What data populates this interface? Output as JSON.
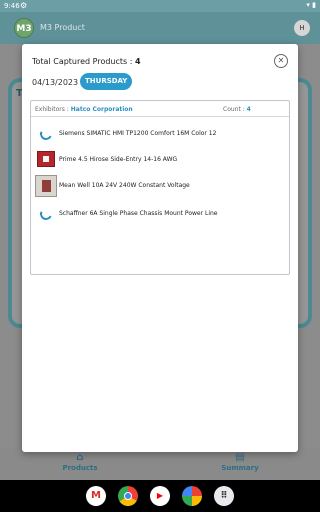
{
  "status_bar": {
    "time": "9:46",
    "gear_icon": "settings-icon",
    "right_icons": "wifi battery"
  },
  "app_bar": {
    "logo": "M3",
    "title": "M3 Product",
    "avatar": "H"
  },
  "background": {
    "title": "T",
    "bottom_nav": [
      {
        "label": "Products",
        "icon": "home-icon"
      },
      {
        "label": "Summary",
        "icon": "clipboard-icon"
      }
    ]
  },
  "modal": {
    "title_label": "Total Captured Products : ",
    "title_count": "4",
    "date": "04/13/2023",
    "day": "THURSDAY",
    "exhibitor_label": "Exhibitors : ",
    "exhibitor_value": "Hatco Corporation",
    "count_label": "Count : ",
    "count_value": "4",
    "products": [
      {
        "name": "Siemens SIMATIC HMI TP1200 Comfort 16M Color 12",
        "thumb": "loading"
      },
      {
        "name": "Prime 4.5 Hirose Side-Entry 14-16 AWG",
        "thumb": "image"
      },
      {
        "name": "Mean Well 10A 24V 240W Constant Voltage",
        "thumb": "image"
      },
      {
        "name": "Schaffner 6A Single Phase Chassis Mount Power Line",
        "thumb": "loading"
      }
    ]
  },
  "nav_apps": [
    "Gmail",
    "Chrome",
    "YouTube",
    "Photos",
    "Apps"
  ],
  "colors": {
    "accent": "#2b9bcb",
    "app_bar": "#5f9199"
  }
}
